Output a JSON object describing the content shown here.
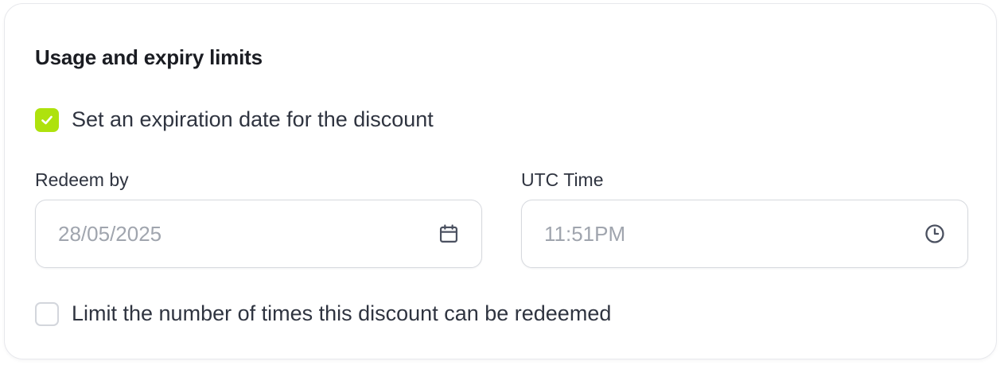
{
  "colors": {
    "accent": "#aee20d",
    "checkmark": "#ffffff",
    "icon": "#4b5160"
  },
  "section": {
    "title": "Usage and expiry limits"
  },
  "expiration_option": {
    "label": "Set an expiration date for the discount",
    "checked": true,
    "icon": "check-icon"
  },
  "redeem_by": {
    "label": "Redeem by",
    "value": "28/05/2025",
    "icon": "calendar-icon"
  },
  "utc_time": {
    "label": "UTC Time",
    "value": "11:51PM",
    "icon": "clock-icon"
  },
  "limit_option": {
    "label": "Limit the number of times this discount can be redeemed",
    "checked": false
  }
}
